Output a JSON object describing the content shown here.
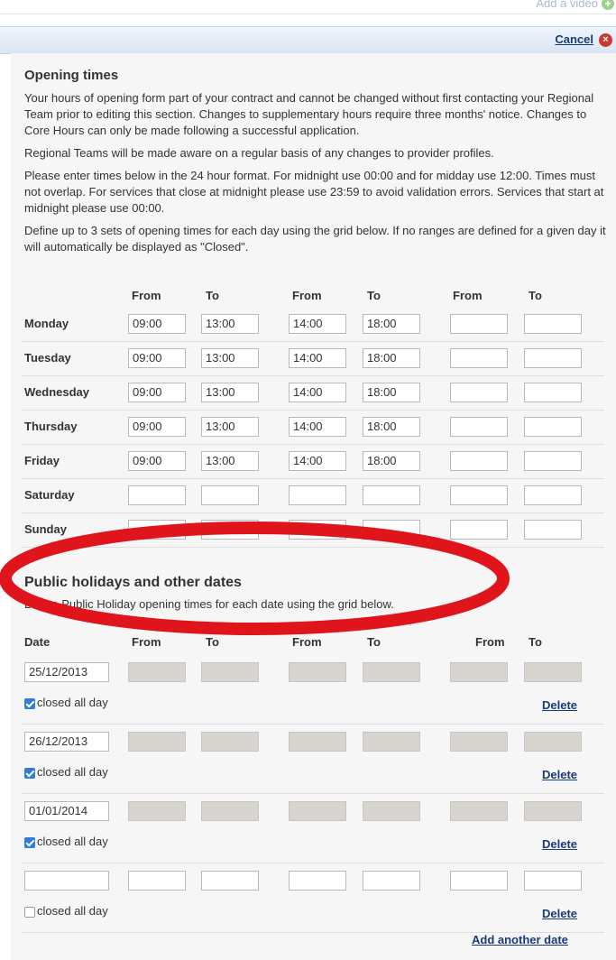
{
  "top": {
    "add_video_label": "Add a video",
    "add_icon": "plus-circle-icon"
  },
  "cancel": {
    "label": "Cancel",
    "icon": "close-circle-icon"
  },
  "opening": {
    "title": "Opening times",
    "paragraphs": [
      "Your hours of opening form part of your contract and cannot be changed without first contacting your Regional Team prior to editing this section. Changes to supplementary hours require three months' notice. Changes to Core Hours can only be made following a successful application.",
      "Regional Teams will be made aware on a regular basis of any changes to provider profiles.",
      "Please enter times below in the 24 hour format. For midnight use 00:00 and for midday use 12:00. Times must not overlap. For services that close at midnight please use 23:59 to avoid validation errors. Services that start at midnight please use 00:00.",
      "Define up to 3 sets of opening times for each day using the grid below. If no ranges are defined for a given day it will automatically be displayed as \"Closed\"."
    ],
    "headers": [
      "From",
      "To",
      "From",
      "To",
      "From",
      "To"
    ],
    "days": [
      {
        "name": "Monday",
        "times": [
          "09:00",
          "13:00",
          "14:00",
          "18:00",
          "",
          ""
        ]
      },
      {
        "name": "Tuesday",
        "times": [
          "09:00",
          "13:00",
          "14:00",
          "18:00",
          "",
          ""
        ]
      },
      {
        "name": "Wednesday",
        "times": [
          "09:00",
          "13:00",
          "14:00",
          "18:00",
          "",
          ""
        ]
      },
      {
        "name": "Thursday",
        "times": [
          "09:00",
          "13:00",
          "14:00",
          "18:00",
          "",
          ""
        ]
      },
      {
        "name": "Friday",
        "times": [
          "09:00",
          "13:00",
          "14:00",
          "18:00",
          "",
          ""
        ]
      },
      {
        "name": "Saturday",
        "times": [
          "",
          "",
          "",
          "",
          "",
          ""
        ]
      },
      {
        "name": "Sunday",
        "times": [
          "",
          "",
          "",
          "",
          "",
          ""
        ]
      }
    ]
  },
  "holidays": {
    "title": "Public holidays and other dates",
    "description": "Define Public Holiday opening times for each date using the grid below.",
    "headers": [
      "Date",
      "From",
      "To",
      "From",
      "To",
      "From",
      "To"
    ],
    "closed_label": "closed all day",
    "delete_label": "Delete",
    "add_label": "Add another date",
    "rows": [
      {
        "date": "25/12/2013",
        "closed": true
      },
      {
        "date": "26/12/2013",
        "closed": true
      },
      {
        "date": "01/01/2014",
        "closed": true
      },
      {
        "date": "",
        "closed": false
      }
    ]
  },
  "colors": {
    "highlight": "#e0141b",
    "link": "#1a3a7a",
    "checkbox": "#2f7dd9"
  }
}
